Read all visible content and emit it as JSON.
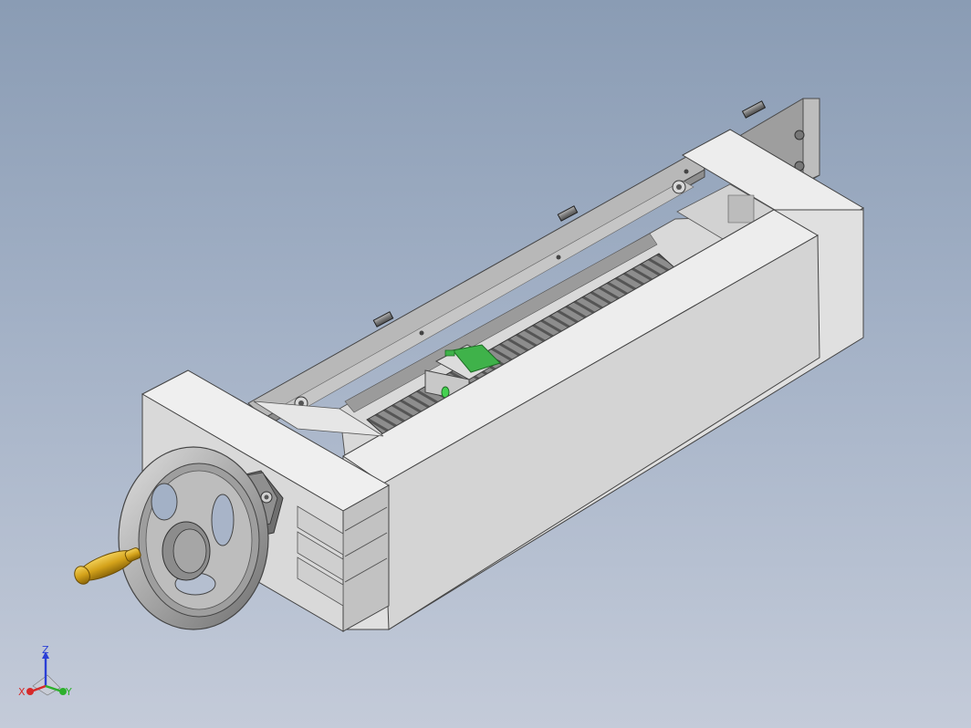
{
  "colors": {
    "background_top": "#8a9cb4",
    "background_bottom": "#c4cbd9",
    "housing_light": "#e6e6e6",
    "housing_mid": "#cfcfcf",
    "housing_shadow": "#bdbdbd",
    "rail_plate": "#a9a9a9",
    "screw": "#8c8c8c",
    "nut_green": "#3fb24a",
    "handle_gold": "#d4a21a",
    "handwheel": "#b5b5b5",
    "axis_x": "#d62a2a",
    "axis_y": "#2cb02c",
    "axis_z": "#2a3fd6"
  },
  "triad": {
    "x_label": "X",
    "y_label": "Y",
    "z_label": "Z"
  }
}
